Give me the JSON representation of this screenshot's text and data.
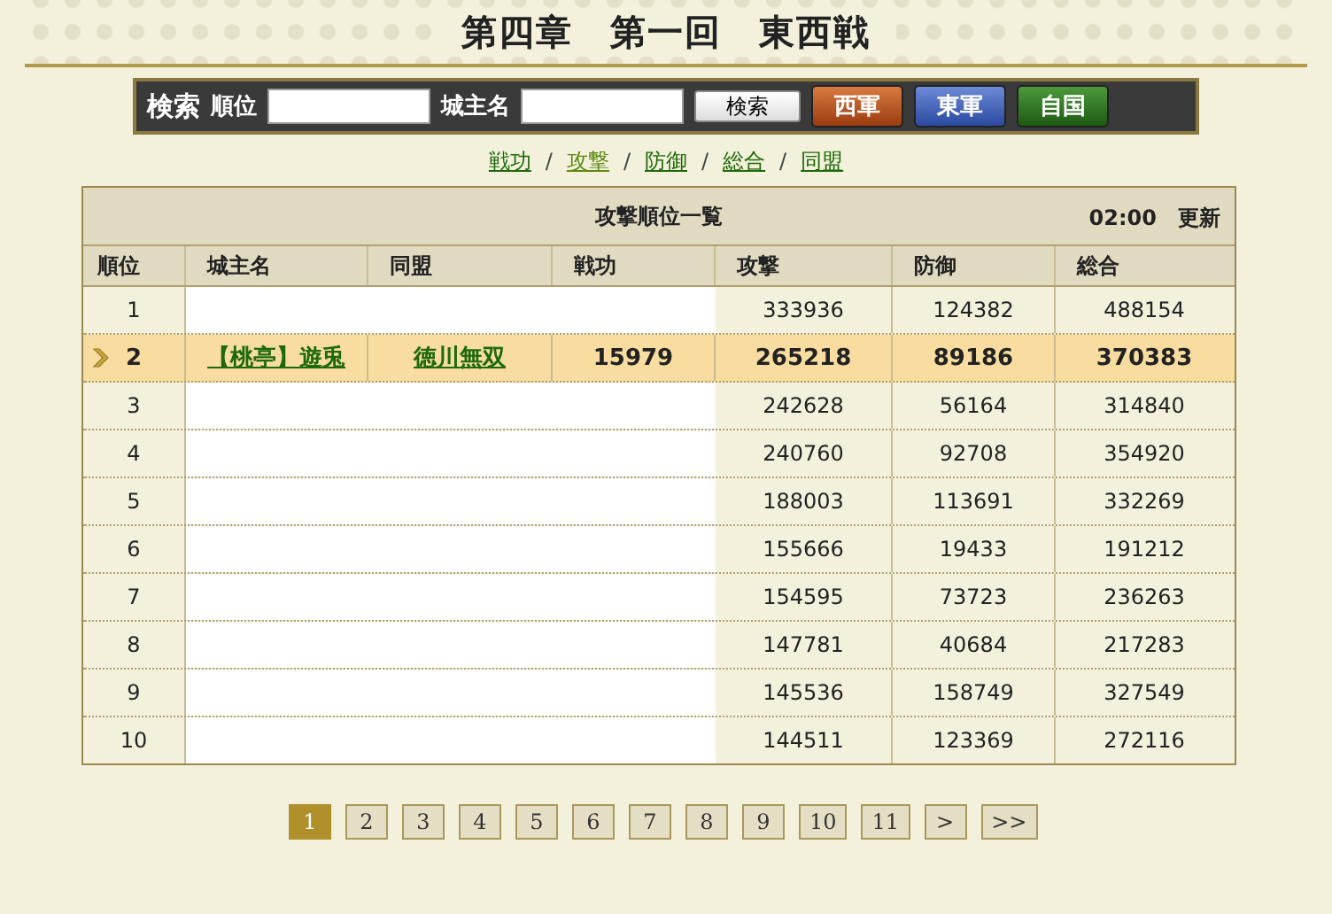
{
  "title": "第四章　第一回　東西戦",
  "search": {
    "heading": "検索",
    "rank_label": "順位",
    "name_label": "城主名",
    "button": "検索",
    "armies": [
      {
        "label": "西軍",
        "kind": "west"
      },
      {
        "label": "東軍",
        "kind": "east"
      },
      {
        "label": "自国",
        "kind": "home"
      }
    ]
  },
  "tabs": [
    {
      "label": "戦功",
      "selected": false
    },
    {
      "label": "攻撃",
      "selected": true
    },
    {
      "label": "防御",
      "selected": false
    },
    {
      "label": "総合",
      "selected": false
    },
    {
      "label": "同盟",
      "selected": false
    }
  ],
  "separator": "/",
  "table": {
    "title": "攻撃順位一覧",
    "updated": "02:00　更新",
    "columns": [
      "順位",
      "城主名",
      "同盟",
      "戦功",
      "攻撃",
      "防御",
      "総合"
    ],
    "rows": [
      {
        "rank": "1",
        "attack": "333936",
        "defense": "124382",
        "total": "488154",
        "selected": false
      },
      {
        "rank": "2",
        "name": "【桃亭】遊兎",
        "alliance": "徳川無双",
        "merit": "15979",
        "attack": "265218",
        "defense": "89186",
        "total": "370383",
        "selected": true
      },
      {
        "rank": "3",
        "attack": "242628",
        "defense": "56164",
        "total": "314840",
        "selected": false
      },
      {
        "rank": "4",
        "attack": "240760",
        "defense": "92708",
        "total": "354920",
        "selected": false
      },
      {
        "rank": "5",
        "attack": "188003",
        "defense": "113691",
        "total": "332269",
        "selected": false
      },
      {
        "rank": "6",
        "attack": "155666",
        "defense": "19433",
        "total": "191212",
        "selected": false
      },
      {
        "rank": "7",
        "attack": "154595",
        "defense": "73723",
        "total": "236263",
        "selected": false
      },
      {
        "rank": "8",
        "attack": "147781",
        "defense": "40684",
        "total": "217283",
        "selected": false
      },
      {
        "rank": "9",
        "attack": "145536",
        "defense": "158749",
        "total": "327549",
        "selected": false
      },
      {
        "rank": "10",
        "attack": "144511",
        "defense": "123369",
        "total": "272116",
        "selected": false
      }
    ]
  },
  "pages": [
    {
      "label": "1",
      "selected": true
    },
    {
      "label": "2",
      "selected": false
    },
    {
      "label": "3",
      "selected": false
    },
    {
      "label": "4",
      "selected": false
    },
    {
      "label": "5",
      "selected": false
    },
    {
      "label": "6",
      "selected": false
    },
    {
      "label": "7",
      "selected": false
    },
    {
      "label": "8",
      "selected": false
    },
    {
      "label": "9",
      "selected": false
    },
    {
      "label": "10",
      "selected": false
    },
    {
      "label": "11",
      "selected": false
    },
    {
      "label": ">",
      "selected": false
    },
    {
      "label": ">>",
      "selected": false
    }
  ]
}
